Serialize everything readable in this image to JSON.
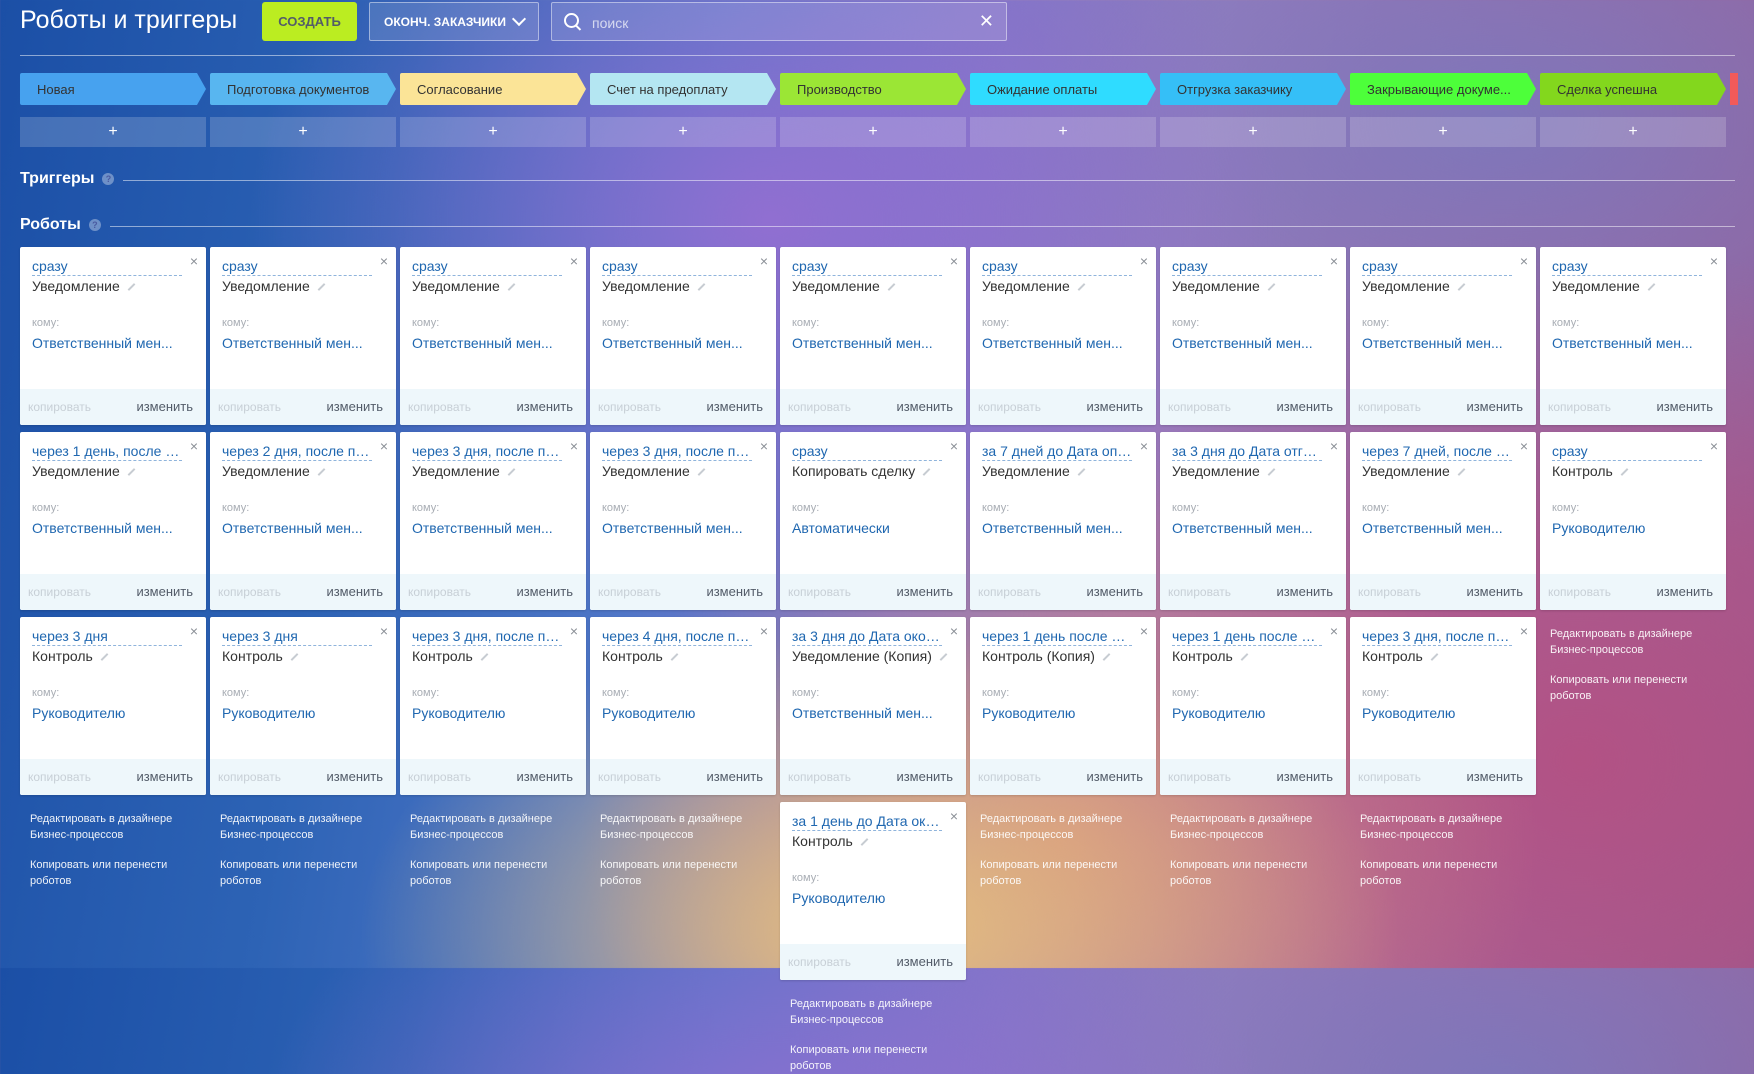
{
  "header": {
    "title": "Роботы и триггеры",
    "create_button": "СОЗДАТЬ",
    "filter_button": "ОКОНЧ. ЗАКАЗЧИКИ",
    "search_placeholder": "поиск",
    "clear_icon": "✕"
  },
  "stages": [
    {
      "label": "Новая",
      "color": "#47a2ef"
    },
    {
      "label": "Подготовка документов",
      "color": "#58b6f0"
    },
    {
      "label": "Согласование",
      "color": "#fbe497"
    },
    {
      "label": "Счет на предоплату",
      "color": "#b4e6f2"
    },
    {
      "label": "Производство",
      "color": "#9be635"
    },
    {
      "label": "Ожидание оплаты",
      "color": "#2fdcff"
    },
    {
      "label": "Отгрузка заказчику",
      "color": "#35bff7"
    },
    {
      "label": "Закрывающие докуме...",
      "color": "#4dff3a"
    },
    {
      "label": "Сделка успешна",
      "color": "#83d71d"
    }
  ],
  "add_label": "+",
  "triggers": {
    "title": "Триггеры",
    "help": "?"
  },
  "robots": {
    "title": "Роботы",
    "help": "?"
  },
  "card_labels": {
    "to": "кому:",
    "copy": "копировать",
    "edit": "изменить",
    "close": "×"
  },
  "links": {
    "designer": "Редактировать в дизайнере Бизнес-процессов",
    "copy_move": "Копировать или перенести роботов"
  },
  "columns": [
    {
      "robots": [
        {
          "delay": "сразу",
          "name": "Уведомление",
          "to": "Ответственный мен..."
        },
        {
          "delay": "через 1 день, после п...",
          "name": "Уведомление",
          "to": "Ответственный мен..."
        },
        {
          "delay": "через 3 дня",
          "name": "Контроль",
          "to": "Руководителю"
        }
      ]
    },
    {
      "robots": [
        {
          "delay": "сразу",
          "name": "Уведомление",
          "to": "Ответственный мен..."
        },
        {
          "delay": "через 2 дня, после пр...",
          "name": "Уведомление",
          "to": "Ответственный мен..."
        },
        {
          "delay": "через 3 дня",
          "name": "Контроль",
          "to": "Руководителю"
        }
      ]
    },
    {
      "robots": [
        {
          "delay": "сразу",
          "name": "Уведомление",
          "to": "Ответственный мен..."
        },
        {
          "delay": "через 3 дня, после пр...",
          "name": "Уведомление",
          "to": "Ответственный мен..."
        },
        {
          "delay": "через 3 дня, после пр...",
          "name": "Контроль",
          "to": "Руководителю"
        }
      ]
    },
    {
      "robots": [
        {
          "delay": "сразу",
          "name": "Уведомление",
          "to": "Ответственный мен..."
        },
        {
          "delay": "через 3 дня, после пр...",
          "name": "Уведомление",
          "to": "Ответственный мен..."
        },
        {
          "delay": "через 4 дня, после пр...",
          "name": "Контроль",
          "to": "Руководителю"
        }
      ]
    },
    {
      "robots": [
        {
          "delay": "сразу",
          "name": "Уведомление",
          "to": "Ответственный мен..."
        },
        {
          "delay": "сразу",
          "name": "Копировать сделку",
          "to": "Автоматически"
        },
        {
          "delay": "за 3 дня до Дата окон...",
          "name": "Уведомление (Копия)",
          "to": "Ответственный мен..."
        },
        {
          "delay": "за 1 день до Дата око...",
          "name": "Контроль",
          "to": "Руководителю"
        }
      ]
    },
    {
      "robots": [
        {
          "delay": "сразу",
          "name": "Уведомление",
          "to": "Ответственный мен..."
        },
        {
          "delay": "за 7 дней до Дата опл...",
          "name": "Уведомление",
          "to": "Ответственный мен..."
        },
        {
          "delay": "через 1 день после Да...",
          "name": "Контроль (Копия)",
          "to": "Руководителю"
        }
      ]
    },
    {
      "robots": [
        {
          "delay": "сразу",
          "name": "Уведомление",
          "to": "Ответственный мен..."
        },
        {
          "delay": "за 3 дня до Дата отгру...",
          "name": "Уведомление",
          "to": "Ответственный мен..."
        },
        {
          "delay": "через 1 день после Да...",
          "name": "Контроль",
          "to": "Руководителю"
        }
      ]
    },
    {
      "robots": [
        {
          "delay": "сразу",
          "name": "Уведомление",
          "to": "Ответственный мен..."
        },
        {
          "delay": "через 7 дней, после п...",
          "name": "Уведомление",
          "to": "Ответственный мен..."
        },
        {
          "delay": "через 3 дня, после пр...",
          "name": "Контроль",
          "to": "Руководителю"
        }
      ]
    },
    {
      "robots": [
        {
          "delay": "сразу",
          "name": "Уведомление",
          "to": "Ответственный мен..."
        },
        {
          "delay": "сразу",
          "name": "Контроль",
          "to": "Руководителю"
        }
      ]
    }
  ]
}
